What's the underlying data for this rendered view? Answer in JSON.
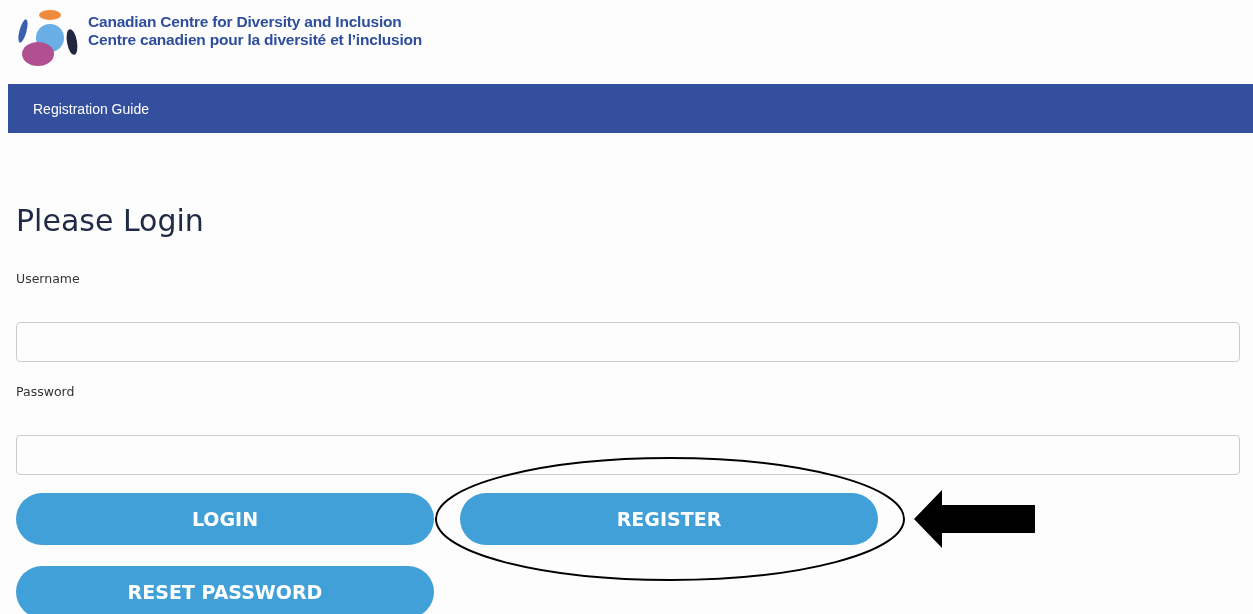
{
  "header": {
    "org_name_en": "Canadian Centre for Diversity and Inclusion",
    "org_name_fr": "Centre canadien pour la diversité et l’inclusion"
  },
  "nav": {
    "items": [
      "Registration Guide"
    ]
  },
  "form": {
    "title": "Please Login",
    "fields": [
      {
        "label": "Username"
      },
      {
        "label": "Password"
      }
    ],
    "button_rows": [
      [
        "LOGIN",
        "REGISTER"
      ],
      [
        "RESET PASSWORD"
      ]
    ]
  }
}
